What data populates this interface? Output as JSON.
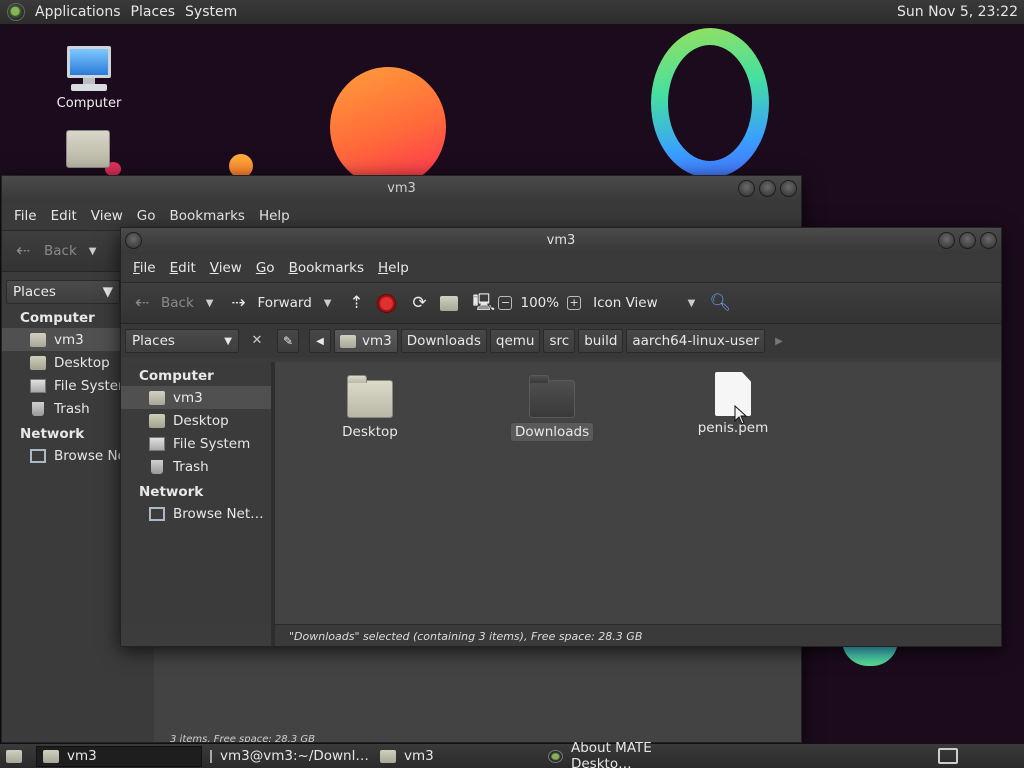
{
  "top_panel": {
    "menus": [
      "Applications",
      "Places",
      "System"
    ],
    "clock": "Sun Nov  5, 23:22"
  },
  "desktop": {
    "icons": [
      {
        "label": "Computer",
        "icon": "computer-icon"
      },
      {
        "label": "",
        "icon": "home-folder-icon"
      }
    ]
  },
  "back_window": {
    "title": "vm3",
    "menus": [
      "File",
      "Edit",
      "View",
      "Go",
      "Bookmarks",
      "Help"
    ],
    "toolbar": {
      "back": "Back"
    },
    "side_combo": "Places",
    "sidebar": {
      "computer_header": "Computer",
      "items": [
        "vm3",
        "Desktop",
        "File System",
        "Trash"
      ],
      "network_header": "Network",
      "network_items": [
        "Browse Net"
      ]
    },
    "status": "3 items, Free space: 28.3 GB"
  },
  "front_window": {
    "title": "vm3",
    "menus": [
      "File",
      "Edit",
      "View",
      "Go",
      "Bookmarks",
      "Help"
    ],
    "toolbar": {
      "back": "Back",
      "forward": "Forward",
      "zoom": "100%",
      "view_mode": "Icon View"
    },
    "side_combo": "Places",
    "breadcrumbs": [
      "vm3",
      "Downloads",
      "qemu",
      "src",
      "build",
      "aarch64-linux-user"
    ],
    "sidebar": {
      "computer_header": "Computer",
      "items": [
        {
          "label": "vm3",
          "icon": "home-icon"
        },
        {
          "label": "Desktop",
          "icon": "folder-icon"
        },
        {
          "label": "File System",
          "icon": "drive-icon"
        },
        {
          "label": "Trash",
          "icon": "trash-icon"
        }
      ],
      "network_header": "Network",
      "network_items": [
        {
          "label": "Browse Net…",
          "icon": "network-icon"
        }
      ]
    },
    "files": [
      {
        "name": "Desktop",
        "icon": "folder-desktop-icon"
      },
      {
        "name": "Downloads",
        "icon": "folder-icon",
        "selected": true
      },
      {
        "name": "penis.pem",
        "icon": "document-icon"
      }
    ],
    "status": "\"Downloads\" selected (containing 3 items), Free space: 28.3 GB"
  },
  "taskbar": {
    "tasks": [
      {
        "label": "vm3",
        "icon": "folder-icon",
        "active": true
      },
      {
        "label": "vm3@vm3:~/Downl…",
        "icon": "terminal-icon"
      },
      {
        "label": "vm3",
        "icon": "folder-icon"
      },
      {
        "label": "About MATE Deskto…",
        "icon": "mate-icon"
      }
    ]
  },
  "colors": {
    "panel": "#2c2c2c",
    "window_bg": "#3c3c3c",
    "content_bg": "#434343",
    "desktop_bg": "#1c0b1d"
  }
}
